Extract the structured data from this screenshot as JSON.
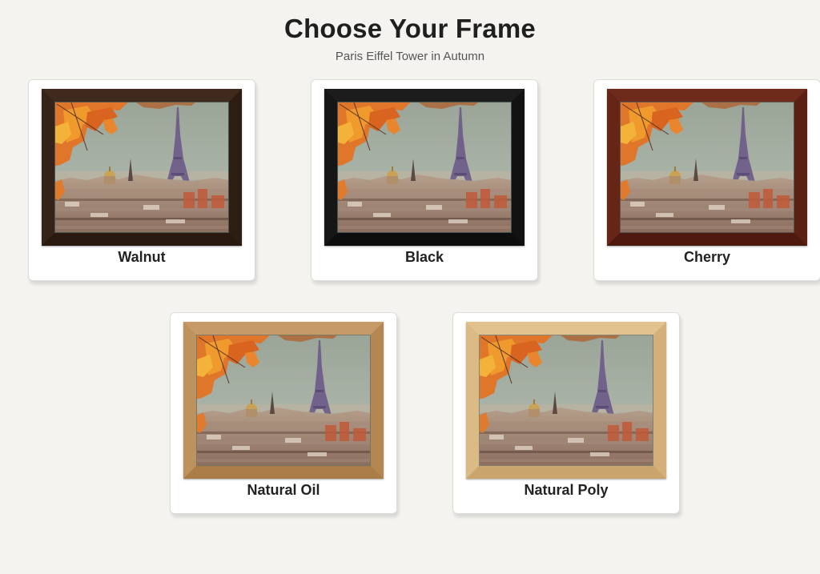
{
  "header": {
    "title": "Choose Your Frame",
    "subtitle": "Paris Eiffel Tower in Autumn"
  },
  "frames": [
    {
      "label": "Walnut",
      "color": "#3f2a1d"
    },
    {
      "label": "Black",
      "color": "#1c1c1c"
    },
    {
      "label": "Cherry",
      "color": "#6e2b1c"
    },
    {
      "label": "Natural Oil",
      "color": "#c69b67"
    },
    {
      "label": "Natural Poly",
      "color": "#e2c38f"
    }
  ],
  "colors": {
    "background": "#f4f3ef",
    "card": "#ffffff",
    "sky": "#a3aea3",
    "leaves": "#e0762a"
  }
}
